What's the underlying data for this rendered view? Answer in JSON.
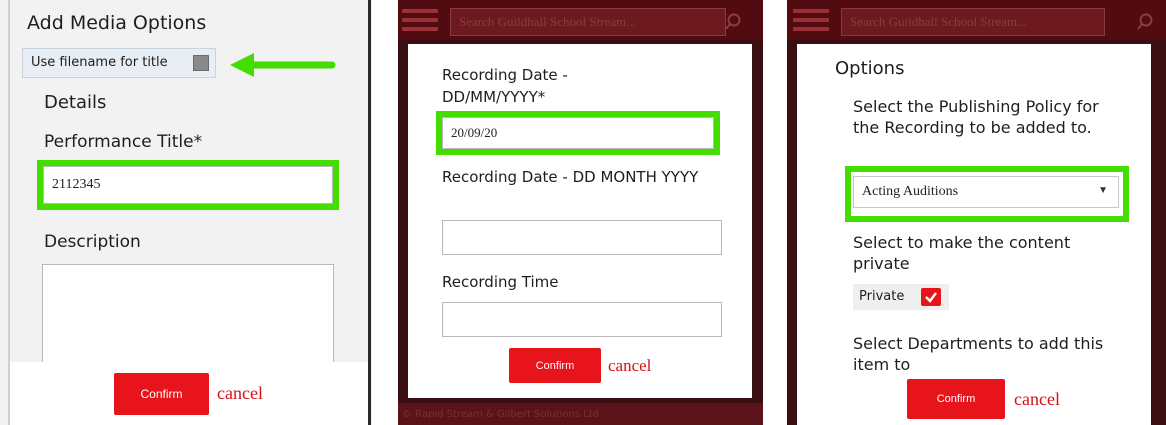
{
  "panel1": {
    "heading": "Add Media Options",
    "use_filename_label": "Use filename for title",
    "details_heading": "Details",
    "performance_title_label": "Performance Title*",
    "performance_title_value": "2112345",
    "description_label": "Description",
    "confirm_label": "Confirm",
    "cancel_label": "cancel"
  },
  "panel2": {
    "search_placeholder": "Search Guildhall School Stream...",
    "recording_date_label": "Recording Date - DD/MM/YYYY*",
    "recording_date_value": "20/09/20",
    "recording_date_month_label": "Recording Date - DD MONTH YYYY",
    "recording_time_label": "Recording Time",
    "confirm_label": "Confirm",
    "cancel_label": "cancel",
    "footer_text": "© Rapid Stream & Gilbert Solutions Ltd"
  },
  "panel3": {
    "search_placeholder": "Search Guildhall School Stream...",
    "options_heading": "Options",
    "policy_prompt": "Select the Publishing Policy for the Recording to be added to.",
    "policy_value": "Acting Auditions",
    "private_prompt": "Select to make the content private",
    "private_label": "Private",
    "private_checked": true,
    "departments_prompt": "Select Departments to add this item to",
    "confirm_label": "Confirm",
    "cancel_label": "cancel"
  },
  "colors": {
    "highlight_green": "#44dd00",
    "confirm_red": "#e8141c",
    "header_maroon": "#520b11"
  },
  "icons": {
    "menu": "hamburger-icon",
    "search": "search-icon",
    "arrow": "left-arrow-icon",
    "checkbox_checked": "checkmark-icon",
    "dropdown": "caret-down-icon"
  }
}
